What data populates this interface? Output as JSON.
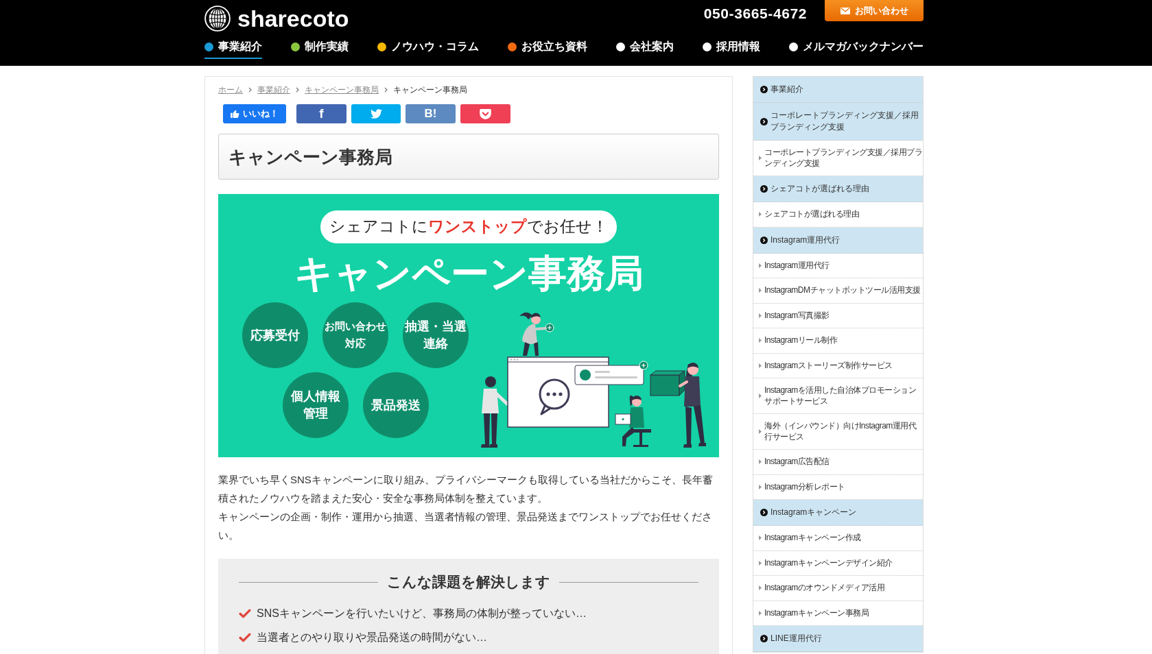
{
  "header": {
    "logo": "sharecoto",
    "phone": "050-3665-4672",
    "contact_button": "お問い合わせ",
    "nav": [
      {
        "label": "事業紹介",
        "color": "#1a9bd7",
        "selected": true
      },
      {
        "label": "制作実績",
        "color": "#8cc63e",
        "selected": false
      },
      {
        "label": "ノウハウ・コラム",
        "color": "#f6b900",
        "selected": false
      },
      {
        "label": "お役立ち資料",
        "color": "#f36a10",
        "selected": false
      },
      {
        "label": "会社案内",
        "color": "#ffffff",
        "selected": false
      },
      {
        "label": "採用情報",
        "color": "#ffffff",
        "selected": false
      },
      {
        "label": "メルマガバックナンバー",
        "color": "#ffffff",
        "selected": false
      }
    ]
  },
  "breadcrumb": [
    {
      "label": "ホーム",
      "kind": "link"
    },
    {
      "label": "事業紹介",
      "kind": "link"
    },
    {
      "label": "キャンペーン事務局",
      "kind": "link"
    },
    {
      "label": "キャンペーン事務局",
      "kind": "current"
    }
  ],
  "share_buttons": [
    {
      "kind": "like",
      "label": "いいね！"
    },
    {
      "kind": "facebook",
      "label": "f"
    },
    {
      "kind": "twitter"
    },
    {
      "kind": "hatena",
      "label": "B!"
    },
    {
      "kind": "pocket"
    }
  ],
  "page_title": "キャンペーン事務局",
  "banner": {
    "tagline": "シェアコトに**ワンストップ**でお任せ！",
    "title": "キャンペーン事務局",
    "services": [
      [
        "応募受付"
      ],
      [
        "お問い合わせ",
        "対応"
      ],
      [
        "抽選・当選",
        "連絡"
      ],
      [
        "個人情報",
        "管理"
      ],
      [
        "景品発送"
      ]
    ]
  },
  "intro": [
    "業界でいち早くSNSキャンペーンに取り組み、プライバシーマークも取得している当社だからこそ、長年蓄積されたノウハウを踏まえた安心・安全な事務局体制を整えています。",
    "キャンペーンの企画・制作・運用から抽選、当選者情報の管理、景品発送までワンストップでお任せください。"
  ],
  "issues": {
    "heading": "こんな課題を解決します",
    "items": [
      "SNSキャンペーンを行いたいけど、事務局の体制が整っていない…",
      "当選者とのやり取りや景品発送の時間がない…"
    ]
  },
  "sidebar": {
    "sections": [
      {
        "label": "事業紹介"
      },
      {
        "label": "コーポレートブランディング支援／採用ブランディング支援",
        "children": [
          {
            "label": "コーポレートブランディング支援／採用ブランディング支援"
          }
        ]
      },
      {
        "label": "シェアコトが選ばれる理由",
        "children": [
          {
            "label": "シェアコトが選ばれる理由"
          }
        ]
      },
      {
        "label": "Instagram運用代行",
        "children": [
          {
            "label": "Instagram運用代行"
          },
          {
            "label": "InstagramDMチャットボットツール活用支援"
          },
          {
            "label": "Instagram写真撮影"
          },
          {
            "label": "Instagramリール制作"
          },
          {
            "label": "Instagramストーリーズ制作サービス"
          },
          {
            "label": "Instagramを活用した自治体プロモーションサポートサービス"
          },
          {
            "label": "海外（インバウンド）向けInstagram運用代行サービス"
          },
          {
            "label": "Instagram広告配信"
          },
          {
            "label": "Instagram分析レポート"
          }
        ]
      },
      {
        "label": "Instagramキャンペーン",
        "children": [
          {
            "label": "Instagramキャンペーン作成"
          },
          {
            "label": "Instagramキャンペーンデザイン紹介"
          },
          {
            "label": "Instagramのオウンドメディア活用"
          },
          {
            "label": "Instagramキャンペーン事務局"
          }
        ]
      },
      {
        "label": "LINE運用代行"
      }
    ]
  }
}
